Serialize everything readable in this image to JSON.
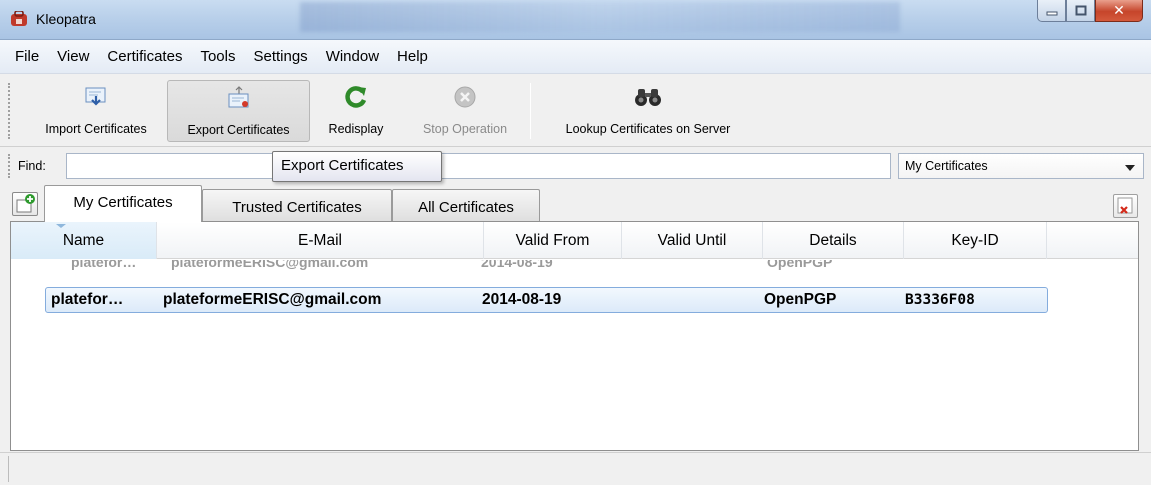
{
  "window": {
    "title": "Kleopatra"
  },
  "menu": [
    "File",
    "View",
    "Certificates",
    "Tools",
    "Settings",
    "Window",
    "Help"
  ],
  "toolbar": {
    "import_label": "Import Certificates",
    "export_label": "Export Certificates",
    "redisplay_label": "Redisplay",
    "stop_label": "Stop Operation",
    "lookup_label": "Lookup Certificates on Server"
  },
  "find": {
    "label": "Find:",
    "value": "",
    "filter_selected": "My Certificates"
  },
  "tooltip": {
    "text": "Export Certificates"
  },
  "tabs": [
    "My Certificates",
    "Trusted Certificates",
    "All Certificates"
  ],
  "table": {
    "columns": [
      "Name",
      "E-Mail",
      "Valid From",
      "Valid Until",
      "Details",
      "Key-ID"
    ],
    "rows": [
      {
        "name": "platefor…",
        "email": "plateformeERISC@gmail.com",
        "valid_from": "2014-08-19",
        "valid_until": "",
        "details": "OpenPGP",
        "key_id": "B3336F08"
      }
    ]
  },
  "colors": {
    "selection": "#dceaf9",
    "selection_border": "#84acdd",
    "titlebar": "#b9d0ea",
    "close_button": "#c6452b"
  }
}
